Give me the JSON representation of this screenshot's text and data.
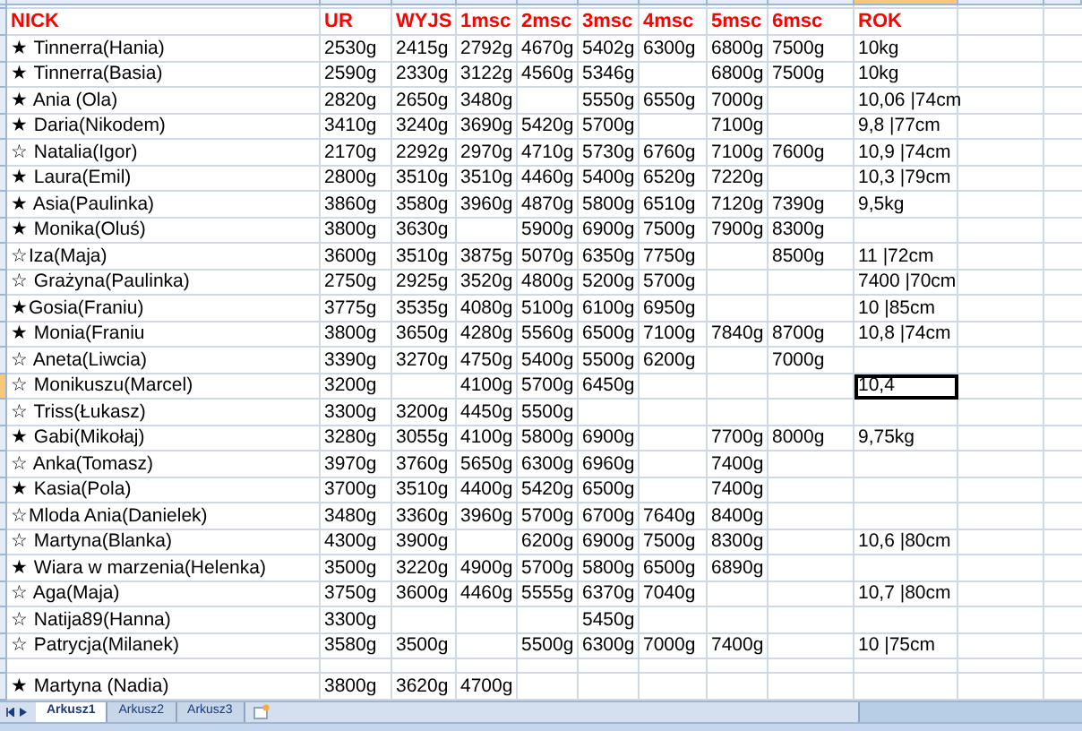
{
  "columns": [
    {
      "label": "NICK",
      "selected": false
    },
    {
      "label": "UR",
      "selected": false
    },
    {
      "label": "WYJS",
      "selected": false
    },
    {
      "label": "1msc",
      "selected": false
    },
    {
      "label": "2msc",
      "selected": false
    },
    {
      "label": "3msc",
      "selected": false
    },
    {
      "label": "4msc",
      "selected": false
    },
    {
      "label": "5msc",
      "selected": false
    },
    {
      "label": "6msc",
      "selected": false
    },
    {
      "label": "ROK",
      "selected": true
    }
  ],
  "rows": [
    {
      "nick": "★ Tinnerra(Hania)",
      "cells": [
        "2530g",
        "2415g",
        "2792g",
        "4670g",
        "5402g",
        "6300g",
        "6800g",
        "7500g",
        "10kg"
      ],
      "selected": false
    },
    {
      "nick": "★ Tinnerra(Basia)",
      "cells": [
        "2590g",
        "2330g",
        "3122g",
        "4560g",
        "5346g",
        null,
        "6800g",
        "7500g",
        "10kg"
      ],
      "selected": false
    },
    {
      "nick": "★ Ania (Ola)",
      "cells": [
        "2820g",
        "2650g",
        "3480g",
        null,
        "5550g",
        "6550g",
        "7000g",
        null,
        "10,06 |74cm"
      ],
      "selected": false
    },
    {
      "nick": "★ Daria(Nikodem)",
      "cells": [
        "3410g",
        "3240g",
        "3690g",
        "5420g",
        "5700g",
        null,
        "7100g",
        null,
        "9,8 |77cm"
      ],
      "selected": false
    },
    {
      "nick": "☆ Natalia(Igor)",
      "cells": [
        "2170g",
        "2292g",
        "2970g",
        "4710g",
        "5730g",
        "6760g",
        "7100g",
        "7600g",
        "10,9 |74cm"
      ],
      "selected": false
    },
    {
      "nick": "★ Laura(Emil)",
      "cells": [
        "2800g",
        "3510g",
        "3510g",
        "4460g",
        "5400g",
        "6520g",
        "7220g",
        null,
        "10,3 |79cm"
      ],
      "selected": false
    },
    {
      "nick": "★ Asia(Paulinka)",
      "cells": [
        "3860g",
        "3580g",
        "3960g",
        "4870g",
        "5800g",
        "6510g",
        "7120g",
        "7390g",
        "9,5kg"
      ],
      "selected": false
    },
    {
      "nick": "★ Monika(Oluś)",
      "cells": [
        "3800g",
        "3630g",
        null,
        "5900g",
        "6900g",
        "7500g",
        "7900g",
        "8300g",
        null
      ],
      "selected": false
    },
    {
      "nick": "☆Iza(Maja)",
      "cells": [
        "3600g",
        "3510g",
        "3875g",
        "5070g",
        "6350g",
        "7750g",
        null,
        "8500g",
        "11 |72cm"
      ],
      "selected": false
    },
    {
      "nick": "☆ Grażyna(Paulinka)",
      "cells": [
        "2750g",
        "2925g",
        "3520g",
        "4800g",
        "5200g",
        "5700g",
        null,
        null,
        "7400 |70cm"
      ],
      "selected": false
    },
    {
      "nick": "★Gosia(Franiu)",
      "cells": [
        "3775g",
        "3535g",
        "4080g",
        "5100g",
        "6100g",
        "6950g",
        null,
        null,
        "10 |85cm"
      ],
      "selected": false
    },
    {
      "nick": "★ Monia(Franiu",
      "cells": [
        "3800g",
        "3650g",
        "4280g",
        "5560g",
        "6500g",
        "7100g",
        "7840g",
        "8700g",
        "10,8 |74cm"
      ],
      "selected": false
    },
    {
      "nick": "☆ Aneta(Liwcia)",
      "cells": [
        "3390g",
        "3270g",
        "4750g",
        "5400g",
        "5500g",
        "6200g",
        null,
        "7000g",
        null
      ],
      "selected": false
    },
    {
      "nick": "☆ Monikuszu(Marcel)",
      "cells": [
        "3200g",
        null,
        "4100g",
        "5700g",
        "6450g",
        null,
        null,
        null,
        "10,4"
      ],
      "selected": true
    },
    {
      "nick": "☆ Triss(Łukasz)",
      "cells": [
        "3300g",
        "3200g",
        "4450g",
        "5500g",
        null,
        null,
        null,
        null,
        null
      ],
      "selected": false
    },
    {
      "nick": "★ Gabi(Mikołaj)",
      "cells": [
        "3280g",
        "3055g",
        "4100g",
        "5800g",
        "6900g",
        null,
        "7700g",
        "8000g",
        "9,75kg"
      ],
      "selected": false
    },
    {
      "nick": "☆ Anka(Tomasz)",
      "cells": [
        "3970g",
        "3760g",
        "5650g",
        "6300g",
        "6960g",
        null,
        "7400g",
        null,
        null
      ],
      "selected": false
    },
    {
      "nick": "★ Kasia(Pola)",
      "cells": [
        "3700g",
        "3510g",
        "4400g",
        "5420g",
        "6500g",
        null,
        "7400g",
        null,
        null
      ],
      "selected": false
    },
    {
      "nick": "☆Mloda Ania(Danielek)",
      "cells": [
        "3480g",
        "3360g",
        "3960g",
        "5700g",
        "6700g",
        "7640g",
        "8400g",
        null,
        null
      ],
      "selected": false
    },
    {
      "nick": "☆ Martyna(Blanka)",
      "cells": [
        "4300g",
        "3900g",
        null,
        "6200g",
        "6900g",
        "7500g",
        "8300g",
        null,
        "10,6 |80cm"
      ],
      "selected": false
    },
    {
      "nick": "★ Wiara w marzenia(Helenka)",
      "cells": [
        "3500g",
        "3220g",
        "4900g",
        "5700g",
        "5800g",
        "6500g",
        "6890g",
        null,
        null
      ],
      "selected": false
    },
    {
      "nick": "☆ Aga(Maja)",
      "cells": [
        "3750g",
        "3600g",
        "4460g",
        "5555g",
        "6370g",
        "7040g",
        null,
        null,
        "10,7 |80cm"
      ],
      "selected": false
    },
    {
      "nick": "☆ Natija89(Hanna)",
      "cells": [
        "3300g",
        null,
        null,
        null,
        "5450g",
        null,
        null,
        null,
        null
      ],
      "selected": false
    },
    {
      "nick": "☆ Patrycja(Milanek)",
      "cells": [
        "3580g",
        "3500g",
        null,
        "5500g",
        "6300g",
        "7000g",
        "7400g",
        null,
        "10 |75cm"
      ],
      "selected": false
    },
    {
      "kind": "blank",
      "selected": false
    },
    {
      "nick": "★ Martyna (Nadia)",
      "cells": [
        "3800g",
        "3620g",
        "4700g",
        null,
        null,
        null,
        null,
        null,
        null
      ],
      "selected": false
    }
  ],
  "sheet_tabs": [
    {
      "label": "Arkusz1",
      "selected": true
    },
    {
      "label": "Arkusz2",
      "selected": false
    },
    {
      "label": "Arkusz3",
      "selected": false
    }
  ]
}
